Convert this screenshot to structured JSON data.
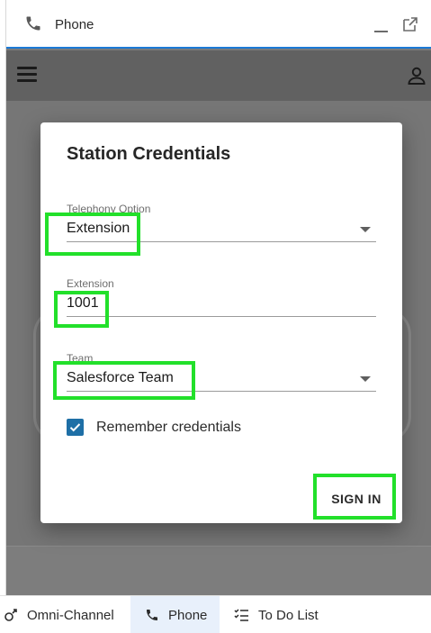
{
  "panel": {
    "title": "Phone",
    "icons": {
      "phone": "phone-icon",
      "minimize": "minimize-icon",
      "popout": "popout-icon"
    }
  },
  "app_bar": {
    "icons": {
      "menu": "hamburger-menu-icon",
      "user": "user-icon"
    }
  },
  "dialog": {
    "title": "Station Credentials",
    "telephony": {
      "label": "Telephony Option",
      "value": "Extension"
    },
    "extension": {
      "label": "Extension",
      "value": "1001"
    },
    "team": {
      "label": "Team",
      "value": "Salesforce Team"
    },
    "remember": {
      "label": "Remember credentials",
      "checked": true
    },
    "signin_label": "SIGN IN"
  },
  "utility_bar": {
    "items": [
      {
        "label": "Omni-Channel",
        "icon": "omni-channel-icon",
        "active": false
      },
      {
        "label": "Phone",
        "icon": "phone-icon",
        "active": true
      },
      {
        "label": "To Do List",
        "icon": "todo-list-icon",
        "active": false
      }
    ]
  },
  "colors": {
    "accent": "#1b7ad6",
    "checkbox": "#1e6fa6",
    "highlight": "#22e02a",
    "active_tab": "#e8f0fb"
  }
}
